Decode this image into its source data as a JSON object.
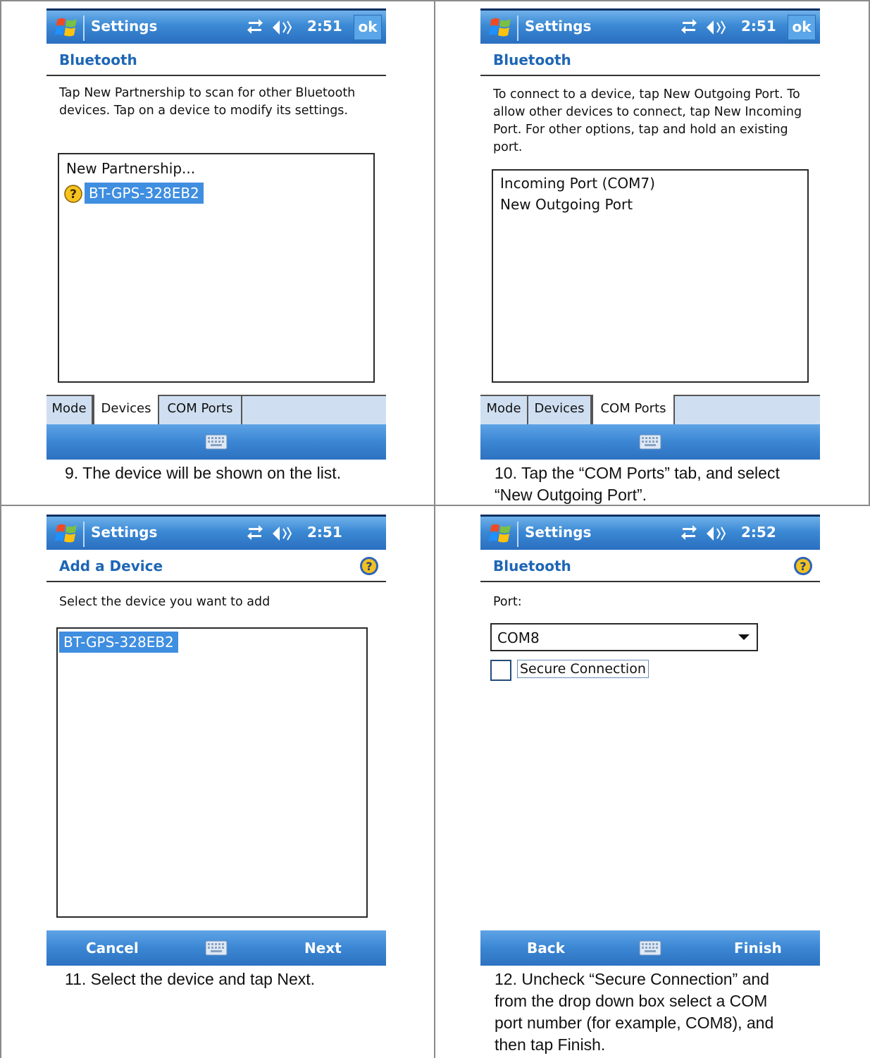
{
  "panels": [
    {
      "title": "Settings",
      "time": "2:51",
      "ok": "ok",
      "header": "Bluetooth",
      "instructions": "Tap New Partnership to scan for other Bluetooth devices. Tap on a device to modify its settings.",
      "list": [
        "New Partnership...",
        "BT-GPS-328EB2"
      ],
      "tabs": [
        "Mode",
        "Devices",
        "COM Ports"
      ],
      "active_tab": "Devices",
      "caption_number": "9.",
      "caption": "The device will be shown on the list."
    },
    {
      "title": "Settings",
      "time": "2:51",
      "ok": "ok",
      "header": "Bluetooth",
      "instructions": "To connect to a device, tap New Outgoing Port. To allow other devices to connect, tap New Incoming Port. For other options, tap and hold an existing port.",
      "list": [
        "Incoming Port (COM7)",
        "New Outgoing Port"
      ],
      "tabs": [
        "Mode",
        "Devices",
        "COM Ports"
      ],
      "active_tab": "COM Ports",
      "caption_number": "10.",
      "caption": "Tap the “COM Ports” tab, and select “New Outgoing Port”."
    },
    {
      "title": "Settings",
      "time": "2:51",
      "header": "Add a Device",
      "instructions": "Select the device you want to add",
      "list": [
        "BT-GPS-328EB2"
      ],
      "left_softkey": "Cancel",
      "right_softkey": "Next",
      "caption_number": "11.",
      "caption": "Select the device and tap Next."
    },
    {
      "title": "Settings",
      "time": "2:52",
      "header": "Bluetooth",
      "port_label": "Port:",
      "port_value": "COM8",
      "secure_label": "Secure Connection",
      "secure_checked": false,
      "left_softkey": "Back",
      "right_softkey": "Finish",
      "caption_number": "12.",
      "caption": "Uncheck “Secure Connection” and from the drop down box select a COM port number (for example, COM8), and then tap Finish."
    }
  ],
  "colors": {
    "titlebar": "#3b89d4",
    "header_text": "#1e66b5",
    "selection": "#3f8ee0",
    "tabbar": "#cfdff1"
  }
}
